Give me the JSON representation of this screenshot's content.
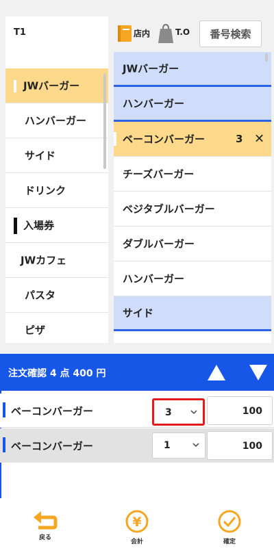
{
  "header": {
    "table_label": "T1",
    "store_label": "店内",
    "takeout_label": "T.O",
    "search_button": "番号検索"
  },
  "categories": [
    {
      "label": "JWバーガー",
      "selected": true
    },
    {
      "label": "ハンバーガー"
    },
    {
      "label": "サイド"
    },
    {
      "label": "ドリンク"
    },
    {
      "label": "入場券",
      "header": true
    },
    {
      "label": "JWカフェ"
    },
    {
      "label": "パスタ"
    },
    {
      "label": "ピザ"
    }
  ],
  "menu": [
    {
      "label": "JWバーガー",
      "type": "group"
    },
    {
      "label": "ハンバーガー",
      "type": "group"
    },
    {
      "label": "ベーコンバーガー",
      "type": "selected",
      "qty": "3",
      "remove": "✕"
    },
    {
      "label": "チーズバーガー"
    },
    {
      "label": "ベジタブルバーガー"
    },
    {
      "label": "ダブルバーガー"
    },
    {
      "label": "ハンバーガー"
    },
    {
      "label": "サイド",
      "type": "group"
    }
  ],
  "confirm": {
    "title": "注文確認  4 点  400 円"
  },
  "order": [
    {
      "name": "ベーコンバーガー",
      "qty": "3",
      "price": "100"
    },
    {
      "name": "ベーコンバーガー",
      "qty": "1",
      "price": "100"
    }
  ],
  "footer": {
    "back": "戻る",
    "checkout": "会計",
    "confirm": "確定"
  },
  "colors": {
    "accent_blue": "#1757e8",
    "selected_yellow": "#fdd98b",
    "group_blue": "#cfdcfa",
    "icon_orange": "#f5a623",
    "highlight_red": "#e21c1c"
  }
}
